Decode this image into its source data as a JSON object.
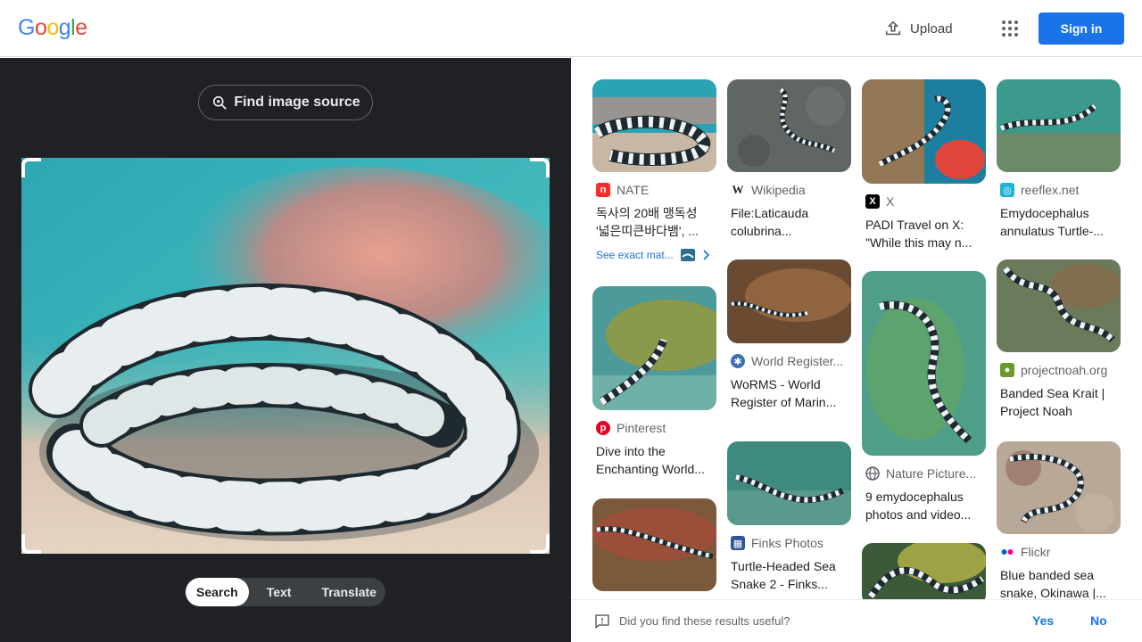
{
  "header": {
    "logo": {
      "g": "G",
      "o1": "o",
      "o2": "o",
      "g2": "g",
      "l": "l",
      "e": "e"
    },
    "upload_label": "Upload",
    "signin_label": "Sign in"
  },
  "left": {
    "find_source_label": "Find image source",
    "tabs": [
      "Search",
      "Text",
      "Translate"
    ],
    "active_tab": "Search"
  },
  "results": {
    "col1": [
      {
        "source": "NATE",
        "title": "독사의 20배 맹독성 '넓은띠큰바다뱀', ...",
        "exact_label": "See exact mat...",
        "favicon": "nate-icon",
        "color": "#ff2a2a"
      },
      {
        "source": "Pinterest",
        "title": "Dive into the Enchanting World...",
        "favicon": "pinterest-icon",
        "color": "#e60023"
      },
      {
        "source": "",
        "title": ""
      }
    ],
    "col2": [
      {
        "source": "Wikipedia",
        "title": "File:Laticauda colubrina...",
        "favicon": "wikipedia-icon",
        "glyph": "W"
      },
      {
        "source": "World Register...",
        "title": "WoRMS - World Register of Marin...",
        "favicon": "worms-icon",
        "color": "#3b6fb6"
      },
      {
        "source": "Finks Photos",
        "title": "Turtle-Headed Sea Snake 2 - Finks...",
        "favicon": "finks-icon",
        "color": "#2f5597"
      }
    ],
    "col3": [
      {
        "source": "X",
        "title": "PADI Travel on X: \"While this may n...",
        "favicon": "x-icon",
        "glyph": "X"
      },
      {
        "source": "Nature Picture...",
        "title": "9 emydocephalus photos and video...",
        "favicon": "globe-icon"
      },
      {
        "source": "",
        "title": ""
      }
    ],
    "col4": [
      {
        "source": "reeflex.net",
        "title": "Emydocephalus annulatus Turtle-...",
        "favicon": "reeflex-icon",
        "color": "#1fb3d5"
      },
      {
        "source": "projectnoah.org",
        "title": "Banded Sea Krait | Project Noah",
        "favicon": "projectnoah-icon",
        "color": "#6a9a2a"
      },
      {
        "source": "Flickr",
        "title": "Blue banded sea snake, Okinawa |...",
        "favicon": "flickr-icon"
      }
    ]
  },
  "feedback": {
    "question": "Did you find these results useful?",
    "yes": "Yes",
    "no": "No"
  },
  "colors": {
    "accent": "#1a73e8",
    "dark_panel": "#202124"
  }
}
